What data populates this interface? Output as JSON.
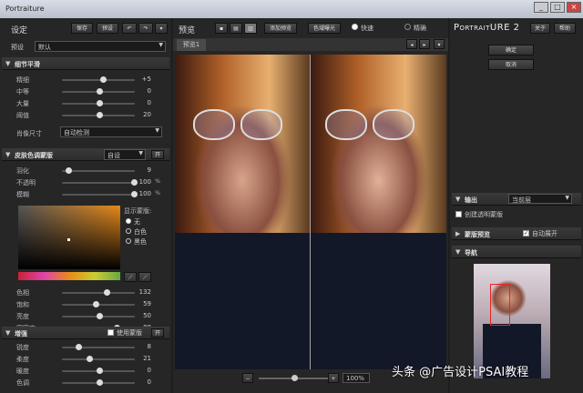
{
  "window": {
    "title": "Portraiture",
    "btn_min": "_",
    "btn_max": "□",
    "btn_close": "×"
  },
  "left": {
    "settings_label": "设定",
    "save_label": "保存",
    "preset_label": "预设",
    "undo_icon": "undo-icon",
    "redo_icon": "redo-icon",
    "preset_row_label": "预设",
    "preset_value": "默认",
    "detail_header": "细节平滑",
    "detail_sliders": [
      {
        "label": "精细",
        "value": "+5",
        "pos": 0.55
      },
      {
        "label": "中等",
        "value": "0",
        "pos": 0.5
      },
      {
        "label": "大量",
        "value": "0",
        "pos": 0.5
      },
      {
        "label": "阈值",
        "value": "20",
        "pos": 0.5
      }
    ],
    "portrait_size_label": "肖像尺寸",
    "portrait_size_value": "自动检测",
    "skin_header": "皮肤色调蒙版",
    "skin_mode": "自设",
    "skin_toggle": "开",
    "skin_sliders": [
      {
        "label": "羽化",
        "value": "9",
        "unit": "",
        "pos": 0.05
      },
      {
        "label": "不透明",
        "value": "100",
        "unit": "%",
        "pos": 1.0
      },
      {
        "label": "模糊",
        "value": "100",
        "unit": "%",
        "pos": 1.0
      }
    ],
    "display_mask_label": "显示蒙版:",
    "mask_options": [
      "无",
      "白色",
      "黑色"
    ],
    "mask_selected": 0,
    "color_sliders": [
      {
        "label": "色相",
        "value": "132",
        "pos": 0.6
      },
      {
        "label": "饱和",
        "value": "59",
        "pos": 0.45
      },
      {
        "label": "亮度",
        "value": "50",
        "pos": 0.5
      },
      {
        "label": "宽容度",
        "value": "88",
        "pos": 0.75
      }
    ],
    "enhance_header": "增强",
    "use_mask_label": "使用蒙版",
    "enhance_toggle": "开",
    "enhance_sliders": [
      {
        "label": "锐度",
        "value": "8",
        "pos": 0.2
      },
      {
        "label": "柔度",
        "value": "21",
        "pos": 0.35
      },
      {
        "label": "暖度",
        "value": "0",
        "pos": 0.5
      },
      {
        "label": "色调",
        "value": "0",
        "pos": 0.5
      }
    ]
  },
  "center": {
    "preview_label": "预览",
    "add_preview_label": "添加预览",
    "gamut_label": "色域曝光",
    "fast_label": "快速",
    "precise_label": "精确",
    "tab_label": "预览1",
    "zoom_value": "100%",
    "zoom_minus": "−",
    "zoom_plus": "+"
  },
  "right": {
    "brand_a": "P",
    "brand_b": "ORTRAIT",
    "brand_c": "URE",
    "brand_version": "2",
    "about_label": "关于",
    "help_label": "帮助",
    "ok_label": "确定",
    "cancel_label": "取消",
    "output_header": "输出",
    "output_value": "当前层",
    "create_transparent_label": "创建透明蒙版",
    "mask_preview_header": "蒙版预览",
    "auto_expand_label": "自动展开",
    "navigator_header": "导航"
  },
  "watermark": "头条 @广告设计PSAI教程",
  "colors": {
    "accent": "#e88a1a",
    "panel": "#262626",
    "header": "#3a3a3a"
  }
}
